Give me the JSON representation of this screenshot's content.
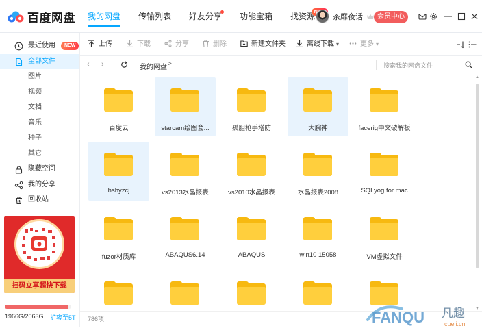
{
  "app": {
    "logo_text": "百度网盘",
    "nav": [
      {
        "label": "我的网盘",
        "active": true
      },
      {
        "label": "传输列表"
      },
      {
        "label": "好友分享",
        "dot": true
      },
      {
        "label": "功能宝箱"
      },
      {
        "label": "找资源",
        "badge": "NEW"
      }
    ],
    "user": {
      "name": "茶靡夜话"
    },
    "member_button": "会员中心",
    "accent_color": "#06a7ff",
    "icons": [
      "mail-icon",
      "settings-icon",
      "minimize-icon",
      "maximize-icon",
      "close-icon"
    ]
  },
  "sidebar": {
    "items": [
      {
        "label": "最近使用",
        "icon": "clock-icon",
        "badge": "NEW"
      },
      {
        "label": "全部文件",
        "icon": "file-icon",
        "active": true
      },
      {
        "label": "图片",
        "sub": true
      },
      {
        "label": "视频",
        "sub": true
      },
      {
        "label": "文档",
        "sub": true
      },
      {
        "label": "音乐",
        "sub": true
      },
      {
        "label": "种子",
        "sub": true
      },
      {
        "label": "其它",
        "sub": true
      },
      {
        "label": "隐藏空间",
        "icon": "lock-icon"
      },
      {
        "label": "我的分享",
        "icon": "share-icon"
      },
      {
        "label": "回收站",
        "icon": "trash-icon"
      }
    ],
    "promo_text": "扫码立享超快下载",
    "quota": {
      "used_label": "1966G/2063G",
      "used_fraction": 0.953,
      "expand_link": "扩容至5T"
    }
  },
  "toolbar": {
    "buttons": [
      {
        "label": "上传",
        "icon": "upload-icon",
        "enabled": true
      },
      {
        "label": "下载",
        "icon": "download-icon",
        "enabled": false
      },
      {
        "label": "分享",
        "icon": "share-icon",
        "enabled": false
      },
      {
        "label": "删除",
        "icon": "trash-icon",
        "enabled": false
      },
      {
        "label": "新建文件夹",
        "icon": "new-folder-icon",
        "enabled": true
      },
      {
        "label": "离线下载",
        "icon": "offline-download-icon",
        "enabled": true,
        "dropdown": true
      },
      {
        "label": "更多",
        "icon": "more-icon",
        "enabled": false,
        "dropdown": true
      }
    ]
  },
  "address": {
    "crumb": "我的网盘",
    "separator": ">",
    "search_placeholder": "搜索我的网盘文件"
  },
  "files": [
    {
      "name": "百度云"
    },
    {
      "name": "starcam绘图套...",
      "selected": true
    },
    {
      "name": "孤胆枪手塔防"
    },
    {
      "name": "大腕神",
      "selected": true
    },
    {
      "name": "facerig中文破解板"
    },
    {
      "name": "hshyzcj",
      "selected": true
    },
    {
      "name": "vs2013水晶报表"
    },
    {
      "name": "vs2010水晶报表"
    },
    {
      "name": "水晶报表2008"
    },
    {
      "name": "SQLyog for mac"
    },
    {
      "name": "fuzor材质库"
    },
    {
      "name": "ABAQUS6.14"
    },
    {
      "name": "ABAQUS"
    },
    {
      "name": "win10 15058"
    },
    {
      "name": "VM虚拟文件"
    },
    {
      "name": ""
    },
    {
      "name": ""
    },
    {
      "name": ""
    },
    {
      "name": ""
    },
    {
      "name": ""
    }
  ],
  "status": {
    "count": "786项"
  },
  "watermark": {
    "text": "FANQU",
    "cn": "凡趣",
    "sub": "cueli.cn"
  }
}
